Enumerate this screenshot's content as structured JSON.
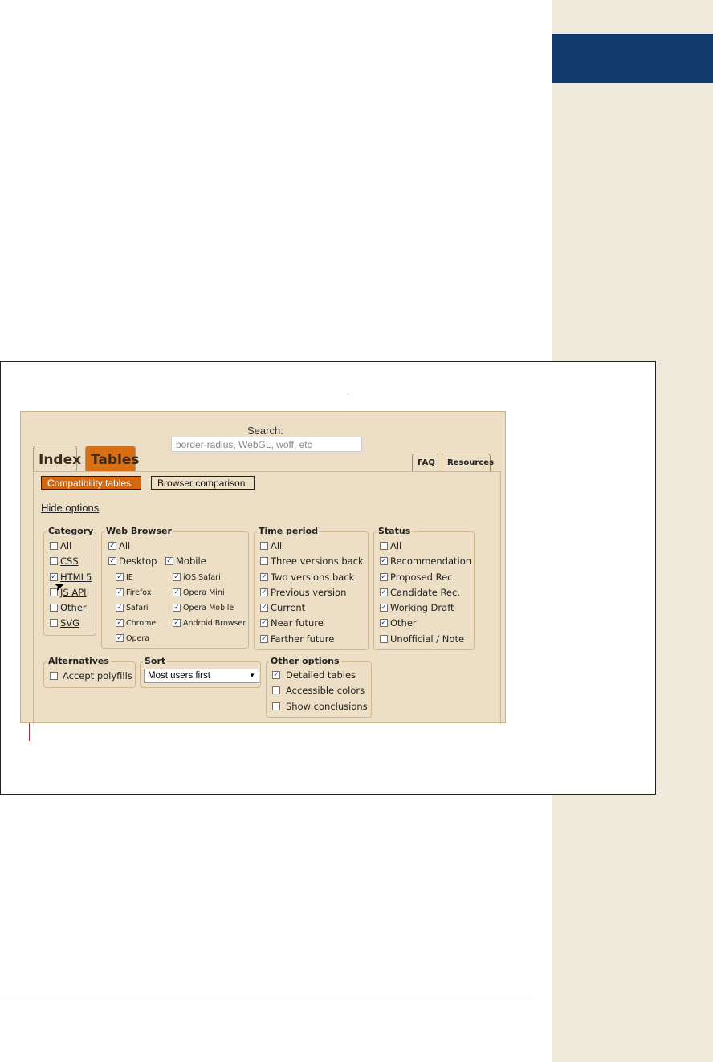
{
  "search": {
    "label": "Search:",
    "placeholder": "border-radius, WebGL, woff, etc"
  },
  "tabs": {
    "index": "Index",
    "tables": "Tables",
    "faq": "FAQ",
    "resources": "Resources"
  },
  "buttons": {
    "compat": "Compatibility tables",
    "browser": "Browser comparison"
  },
  "hide_options": "Hide options",
  "category": {
    "legend": "Category",
    "items": [
      {
        "label": "All",
        "checked": false
      },
      {
        "label": "CSS",
        "checked": false
      },
      {
        "label": "HTML5",
        "checked": true
      },
      {
        "label": "JS API",
        "checked": false
      },
      {
        "label": "Other",
        "checked": false
      },
      {
        "label": "SVG",
        "checked": false
      }
    ]
  },
  "web_browser": {
    "legend": "Web Browser",
    "all": "All",
    "desktop": "Desktop",
    "mobile": "Mobile",
    "desktop_items": [
      "IE",
      "Firefox",
      "Safari",
      "Chrome",
      "Opera"
    ],
    "mobile_items": [
      "iOS Safari",
      "Opera Mini",
      "Opera Mobile",
      "Android Browser"
    ]
  },
  "time_period": {
    "legend": "Time period",
    "items": [
      {
        "label": "All",
        "checked": false
      },
      {
        "label": "Three versions back",
        "checked": false
      },
      {
        "label": "Two versions back",
        "checked": true
      },
      {
        "label": "Previous version",
        "checked": true
      },
      {
        "label": "Current",
        "checked": true
      },
      {
        "label": "Near future",
        "checked": true
      },
      {
        "label": "Farther future",
        "checked": true
      }
    ]
  },
  "status": {
    "legend": "Status",
    "items": [
      {
        "label": "All",
        "checked": false
      },
      {
        "label": "Recommendation",
        "checked": true
      },
      {
        "label": "Proposed Rec.",
        "checked": true
      },
      {
        "label": "Candidate Rec.",
        "checked": true
      },
      {
        "label": "Working Draft",
        "checked": true
      },
      {
        "label": "Other",
        "checked": true
      },
      {
        "label": "Unofficial / Note",
        "checked": false
      }
    ]
  },
  "alternatives": {
    "legend": "Alternatives",
    "polyfills": "Accept polyfills"
  },
  "sort": {
    "legend": "Sort",
    "selected": "Most users first"
  },
  "other_options": {
    "legend": "Other options",
    "detailed": "Detailed tables",
    "accessible": "Accessible colors",
    "conclusions": "Show conclusions"
  }
}
